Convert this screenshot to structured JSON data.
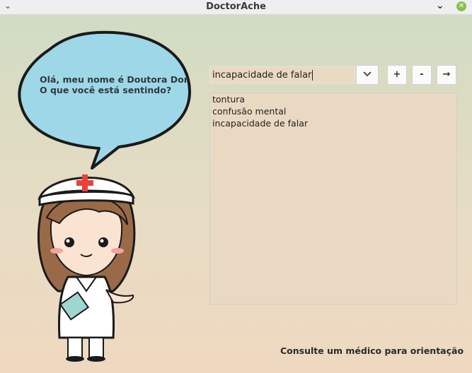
{
  "window": {
    "title": "DoctorAche",
    "menu_icon": "chevron-down-icon",
    "minimize_icon": "chevron-down-icon",
    "close_icon": "close-icon"
  },
  "assistant": {
    "greeting_line1": "Olá, meu nome é Doutora Dor",
    "greeting_line2": "O que você está sentindo?"
  },
  "symptom_input": {
    "value": "incapacidade de falar",
    "dropdown_icon": "chevron-down-icon"
  },
  "buttons": {
    "add_label": "+",
    "remove_label": "-",
    "submit_label": "→"
  },
  "symptoms_list": {
    "items": [
      "tontura",
      "confusão mental",
      "incapacidade de falar"
    ]
  },
  "footer": {
    "advice": "Consulte um médico para orientação"
  }
}
